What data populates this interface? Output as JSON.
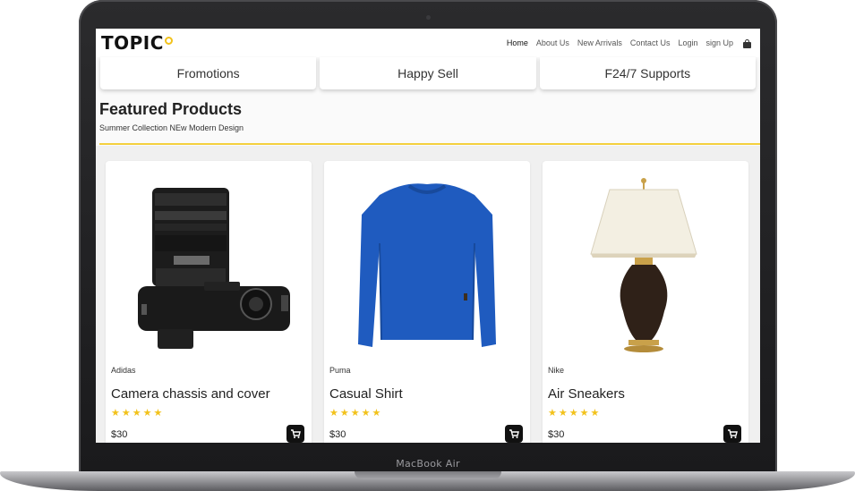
{
  "device": {
    "model_label": "MacBook Air"
  },
  "navbar": {
    "logo": "TOPIC",
    "links": [
      {
        "label": "Home",
        "active": true
      },
      {
        "label": "About Us"
      },
      {
        "label": "New Arrivals"
      },
      {
        "label": "Contact Us"
      },
      {
        "label": "Login"
      },
      {
        "label": "sign Up"
      }
    ],
    "cart_icon": "shopping-bag-icon"
  },
  "features": [
    "Fromotions",
    "Happy Sell",
    "F24/7 Supports"
  ],
  "section": {
    "title": "Featured Products",
    "subtitle": "Summer Collection NEw Modern Design"
  },
  "products": [
    {
      "brand": "Adidas",
      "name": "Camera chassis and cover",
      "price": "$30",
      "rating": 5,
      "image": "camera-image"
    },
    {
      "brand": "Puma",
      "name": "Casual Shirt",
      "price": "$30",
      "rating": 5,
      "image": "sweater-image"
    },
    {
      "brand": "Nike",
      "name": "Air Sneakers",
      "price": "$30",
      "rating": 5,
      "image": "lamp-image"
    }
  ],
  "colors": {
    "accent": "#f2c21b",
    "text": "#222222",
    "cart_button": "#111111"
  }
}
